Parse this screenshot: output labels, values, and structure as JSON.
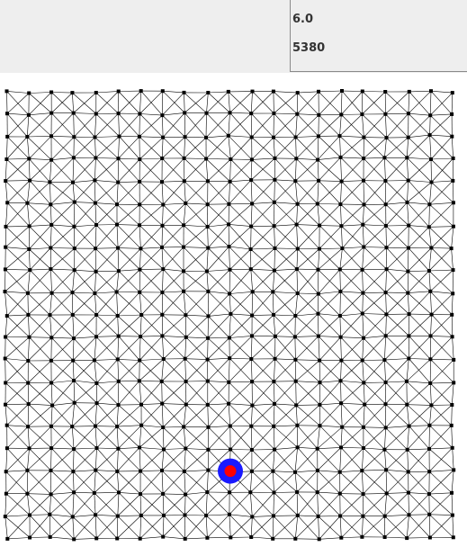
{
  "info_panel": {
    "line1": "6.0",
    "line2": "5380"
  },
  "mesh": {
    "grid_rows": 20,
    "grid_cols": 20,
    "diagonals": true,
    "line_color": "#000000",
    "node_color": "#000000",
    "marker": {
      "outer_color": "#1a1aff",
      "inner_color": "#ff0000"
    }
  }
}
